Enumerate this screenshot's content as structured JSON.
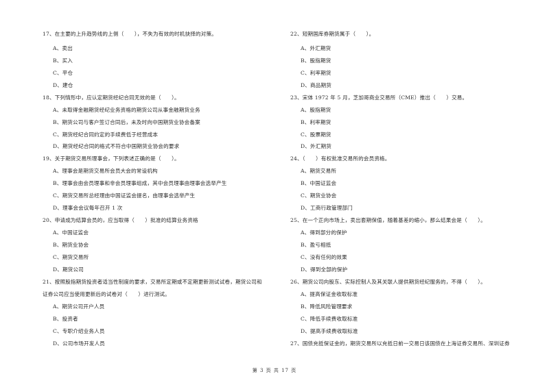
{
  "questions_left": [
    {
      "stem": [
        "17、在主要的上升趋势线的上侧（　　），不失为有效的时机抉择的对策。"
      ],
      "options": [
        "A、卖出",
        "B、买入",
        "C、平仓",
        "D、建仓"
      ]
    },
    {
      "stem": [
        "18、下列情形中，应认定期货经纪合同无效的是（　　）。"
      ],
      "options": [
        "A、未取得金融期货经纪业务资格的期货公司从事金融期货业务",
        "B、期货公司与客户签订合同后，未及时向中国期货业协会备案",
        "C、期货经纪合同约定的手续费低于经营成本",
        "D、期货经纪合同的格式不符合中国期货业协会的要求"
      ]
    },
    {
      "stem": [
        "19、关于期货交易所理事会，下列表述正确的是（　　）。"
      ],
      "options": [
        "A、理事会是期货交易所会员大会的常设机构",
        "B、理事会由会员理事和非会员理事组成，其中会员理事由理事会选举产生",
        "C、期货交易所总经理由中国证监会提名，由理事会选举产生",
        "D、理事会会议每年召开 1 次"
      ]
    },
    {
      "stem": [
        "20、申请成为结算会员的，应当取得（　　）批准的结算业务资格"
      ],
      "options": [
        "A、中国证监会",
        "B、期货业协会",
        "C、期货交易所",
        "D、期货公司"
      ]
    },
    {
      "stem": [
        "21、按照股指期货投资者适当性制度的要求，交易所定期或不定期更新测试试卷，期货公司和",
        "证券公司应当使用更新后的试卷对（　　）进行测试。"
      ],
      "options": [
        "A、期货公司开户人员",
        "B、投资者",
        "C、专职介绍业务人员",
        "D、公司市场开发人员"
      ]
    }
  ],
  "questions_right": [
    {
      "stem": [
        "22、短期国库券期货属于（　　）。"
      ],
      "options": [
        "A、外汇期货",
        "B、股指期货",
        "C、利率期货",
        "D、商品期货"
      ]
    },
    {
      "stem": [
        "23、宋体 1972 年 5 月，芝加哥商业交易所（CME）推出（　　）交易。"
      ],
      "options": [
        "A、股指期货",
        "B、利率期货",
        "C、股票期货",
        "D、外汇期货"
      ]
    },
    {
      "stem": [
        "24、（　　）有权批准交易所的会员资格。"
      ],
      "options": [
        "A、期货交易所",
        "B、中国证监会",
        "C、期货业协会",
        "D、工商行政管理部门"
      ]
    },
    {
      "stem": [
        "25、在一个正向市场上，卖出套期保值，随着基差的缩小，那么结果会是（　　）。"
      ],
      "options": [
        "A、得到部分的保护",
        "B、盈亏相抵",
        "C、没有任何的效果",
        "D、得到全部的保护"
      ]
    },
    {
      "stem": [
        "26、期货公司向股东、实际控制人及其关联人提供期货经纪服务的，不得（　　）。"
      ],
      "options": [
        "A、提高保证金收取标准",
        "B、降低风险管理要求",
        "C、降低手续费收取标准",
        "D、提高手续费收取标准"
      ]
    },
    {
      "stem": [
        "27、国债充抵保证金的，期货交易所以充抵日前一交易日该国债在上海证券交易所、深圳证券"
      ],
      "options": []
    }
  ],
  "footer": {
    "page_label": "第 3 页 共 17 页"
  }
}
